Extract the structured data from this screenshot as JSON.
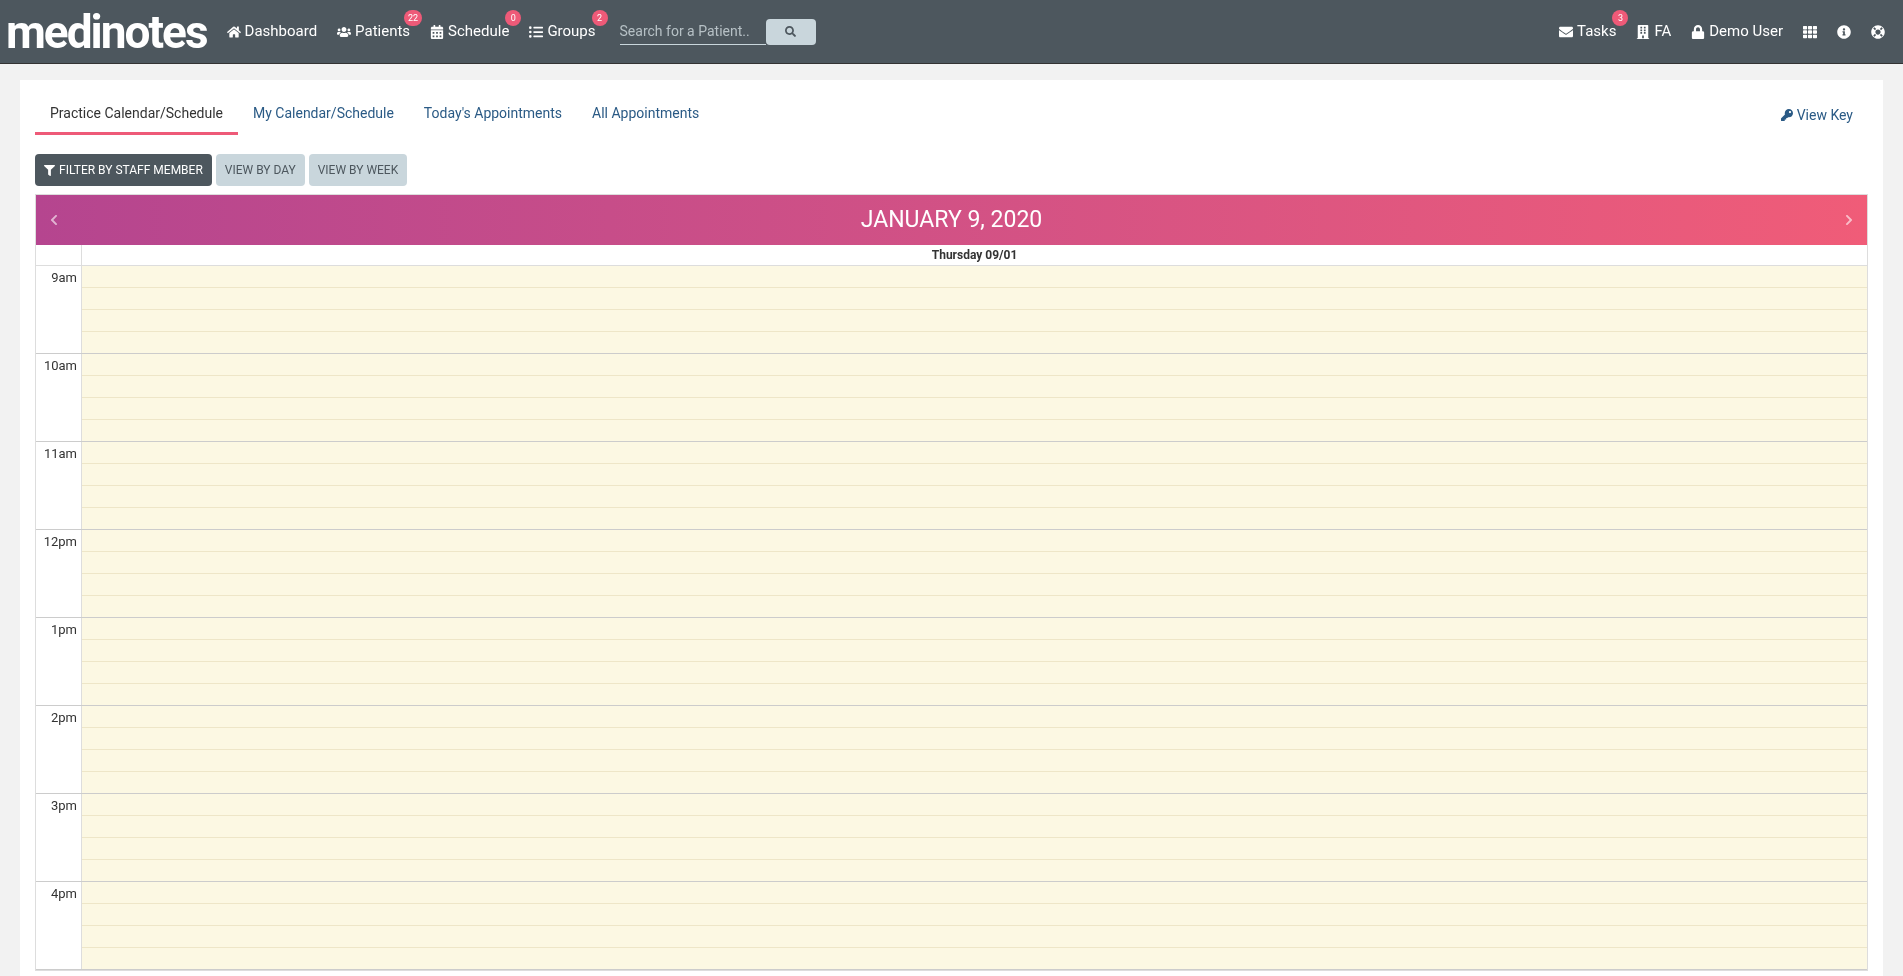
{
  "brand": {
    "name": "medinotes"
  },
  "nav": [
    {
      "kind": "home",
      "label": "Dashboard"
    },
    {
      "kind": "users",
      "label": "Patients",
      "badge": "22"
    },
    {
      "kind": "calendar",
      "label": "Schedule",
      "badge": "0"
    },
    {
      "kind": "list",
      "label": "Groups",
      "badge": "2"
    }
  ],
  "search": {
    "placeholder": "Search for a Patient.."
  },
  "nav_right": [
    {
      "kind": "mail",
      "label": "Tasks",
      "badge": "3"
    },
    {
      "kind": "building",
      "label": "FA"
    },
    {
      "kind": "lock",
      "label": "Demo User"
    },
    {
      "kind": "grid"
    },
    {
      "kind": "info"
    },
    {
      "kind": "lifebuoy"
    }
  ],
  "tabs": [
    {
      "label": "Practice Calendar/Schedule",
      "selected": true
    },
    {
      "label": "My Calendar/Schedule",
      "selected": false
    },
    {
      "label": "Today's Appointments",
      "selected": false
    },
    {
      "label": "All Appointments",
      "selected": false
    }
  ],
  "view_key": "View Key",
  "buttons": [
    {
      "kind": "filter",
      "label": "FILTER BY STAFF MEMBER",
      "selected": true
    },
    {
      "kind": "plain",
      "label": "VIEW BY DAY",
      "selected": false
    },
    {
      "kind": "plain",
      "label": "VIEW BY WEEK",
      "selected": false
    }
  ],
  "calendar": {
    "title": "JANUARY 9, 2020",
    "day_header": "Thursday 09/01",
    "hours": [
      "9am",
      "10am",
      "11am",
      "12pm",
      "1pm",
      "2pm",
      "3pm",
      "4pm"
    ]
  }
}
